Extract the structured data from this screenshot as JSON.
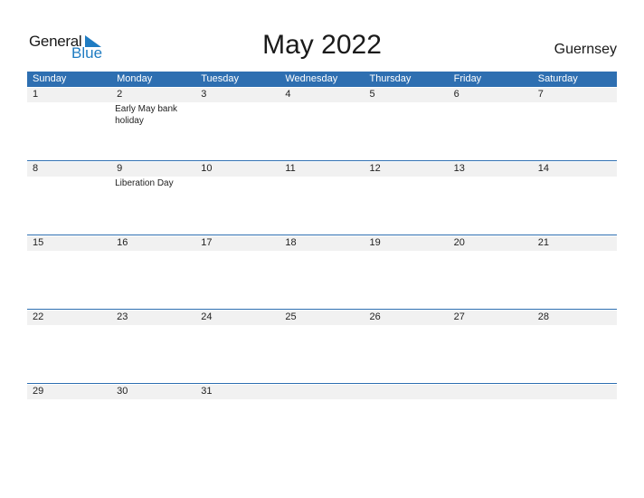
{
  "logo": {
    "word1": "General",
    "word2": "Blue"
  },
  "title": "May 2022",
  "country": "Guernsey",
  "colors": {
    "header": "#2e6fb1",
    "strip": "#f1f1f1",
    "accent": "#1f7cc2"
  },
  "weekdays": [
    "Sunday",
    "Monday",
    "Tuesday",
    "Wednesday",
    "Thursday",
    "Friday",
    "Saturday"
  ],
  "weeks": [
    {
      "days": [
        {
          "n": "1",
          "ev": ""
        },
        {
          "n": "2",
          "ev": "Early May bank holiday"
        },
        {
          "n": "3",
          "ev": ""
        },
        {
          "n": "4",
          "ev": ""
        },
        {
          "n": "5",
          "ev": ""
        },
        {
          "n": "6",
          "ev": ""
        },
        {
          "n": "7",
          "ev": ""
        }
      ]
    },
    {
      "days": [
        {
          "n": "8",
          "ev": ""
        },
        {
          "n": "9",
          "ev": "Liberation Day"
        },
        {
          "n": "10",
          "ev": ""
        },
        {
          "n": "11",
          "ev": ""
        },
        {
          "n": "12",
          "ev": ""
        },
        {
          "n": "13",
          "ev": ""
        },
        {
          "n": "14",
          "ev": ""
        }
      ]
    },
    {
      "days": [
        {
          "n": "15",
          "ev": ""
        },
        {
          "n": "16",
          "ev": ""
        },
        {
          "n": "17",
          "ev": ""
        },
        {
          "n": "18",
          "ev": ""
        },
        {
          "n": "19",
          "ev": ""
        },
        {
          "n": "20",
          "ev": ""
        },
        {
          "n": "21",
          "ev": ""
        }
      ]
    },
    {
      "days": [
        {
          "n": "22",
          "ev": ""
        },
        {
          "n": "23",
          "ev": ""
        },
        {
          "n": "24",
          "ev": ""
        },
        {
          "n": "25",
          "ev": ""
        },
        {
          "n": "26",
          "ev": ""
        },
        {
          "n": "27",
          "ev": ""
        },
        {
          "n": "28",
          "ev": ""
        }
      ]
    },
    {
      "days": [
        {
          "n": "29",
          "ev": ""
        },
        {
          "n": "30",
          "ev": ""
        },
        {
          "n": "31",
          "ev": ""
        },
        {
          "n": "",
          "ev": ""
        },
        {
          "n": "",
          "ev": ""
        },
        {
          "n": "",
          "ev": ""
        },
        {
          "n": "",
          "ev": ""
        }
      ]
    }
  ]
}
